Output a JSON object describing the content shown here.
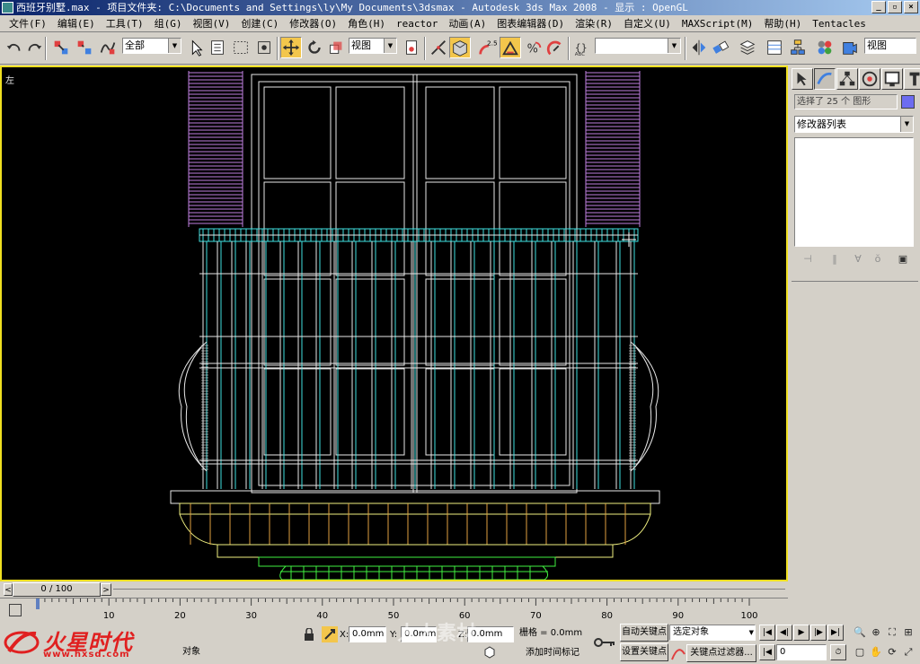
{
  "window": {
    "title": "西班牙别墅.max    - 项目文件夹: C:\\Documents and Settings\\ly\\My Documents\\3dsmax    - Autodesk 3ds Max 2008    - 显示 : OpenGL"
  },
  "menu": {
    "items": [
      "文件(F)",
      "编辑(E)",
      "工具(T)",
      "组(G)",
      "视图(V)",
      "创建(C)",
      "修改器(O)",
      "角色(H)",
      "reactor",
      "动画(A)",
      "图表编辑器(D)",
      "渲染(R)",
      "自定义(U)",
      "MAXScript(M)",
      "帮助(H)",
      "Tentacles"
    ]
  },
  "toolbar": {
    "selection_filter": "全部",
    "ref_coord": "视图",
    "angle_snap": "2.5",
    "named_selection": "",
    "render_viewport": "视图"
  },
  "viewport": {
    "label": "左",
    "border_color": "#f0e020",
    "wire_colors": {
      "shutter": "#c080e0",
      "window": "#e8e8e8",
      "rail": "#40e0e0",
      "base_yellow": "#f0f080",
      "base_green": "#40f040",
      "base_orange": "#e0a040"
    }
  },
  "command_panel": {
    "selection_text": "选择了 25 个 图形",
    "selection_color": "#6c6cf0",
    "modifier_list": "修改器列表"
  },
  "timeline": {
    "frame_display": "0 / 100",
    "ticks": [
      10,
      20,
      30,
      40,
      50,
      60,
      70,
      80,
      90,
      100
    ]
  },
  "status": {
    "logo_text": "火星时代",
    "logo_url": "www.hxsd.com",
    "prompt_tail": "对象",
    "x_label": "X:",
    "x_value": "0.0mm",
    "y_label": "Y:",
    "y_value": "0.0mm",
    "z_label": "Z:",
    "z_value": "0.0mm",
    "grid": "栅格 = 0.0mm",
    "add_time_tag": "添加时间标记",
    "auto_key": "自动关键点",
    "set_key": "设置关键点",
    "key_mode": "选定对象",
    "key_filters": "关键点过滤器...",
    "current_frame": "0",
    "watermark": "人人素材"
  }
}
